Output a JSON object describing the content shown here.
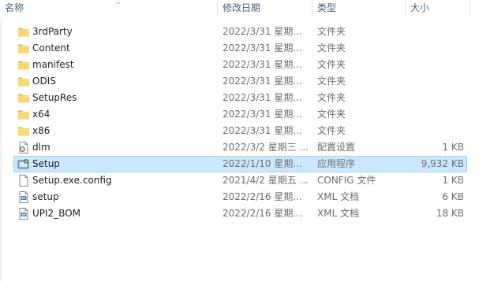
{
  "columns": {
    "name": "名称",
    "date": "修改日期",
    "type": "类型",
    "size": "大小"
  },
  "sort_indicator": "^",
  "files": [
    {
      "name": "3rdParty",
      "date": "2022/3/31 星期...",
      "type": "文件夹",
      "size": "",
      "icon": "folder-icon"
    },
    {
      "name": "Content",
      "date": "2022/3/31 星期...",
      "type": "文件夹",
      "size": "",
      "icon": "folder-icon"
    },
    {
      "name": "manifest",
      "date": "2022/3/31 星期...",
      "type": "文件夹",
      "size": "",
      "icon": "folder-icon"
    },
    {
      "name": "ODIS",
      "date": "2022/3/31 星期...",
      "type": "文件夹",
      "size": "",
      "icon": "folder-icon"
    },
    {
      "name": "SetupRes",
      "date": "2022/3/31 星期...",
      "type": "文件夹",
      "size": "",
      "icon": "folder-icon"
    },
    {
      "name": "x64",
      "date": "2022/3/31 星期...",
      "type": "文件夹",
      "size": "",
      "icon": "folder-icon"
    },
    {
      "name": "x86",
      "date": "2022/3/31 星期...",
      "type": "文件夹",
      "size": "",
      "icon": "folder-icon"
    },
    {
      "name": "dlm",
      "date": "2022/3/2 星期三 ...",
      "type": "配置设置",
      "size": "1 KB",
      "icon": "config-file-icon"
    },
    {
      "name": "Setup",
      "date": "2022/1/10 星期...",
      "type": "应用程序",
      "size": "9,932 KB",
      "icon": "setup-app-icon",
      "selected": true
    },
    {
      "name": "Setup.exe.config",
      "date": "2021/4/2 星期五 ...",
      "type": "CONFIG 文件",
      "size": "1 KB",
      "icon": "document-icon"
    },
    {
      "name": "setup",
      "date": "2022/2/16 星期...",
      "type": "XML 文档",
      "size": "6 KB",
      "icon": "xml-file-icon"
    },
    {
      "name": "UPI2_BOM",
      "date": "2022/2/16 星期...",
      "type": "XML 文档",
      "size": "18 KB",
      "icon": "xml-file-icon"
    }
  ],
  "colors": {
    "folder": "#f8d775",
    "selection_bg": "#cce8ff",
    "selection_border": "#99d1ff",
    "header_text": "#4c607a"
  }
}
